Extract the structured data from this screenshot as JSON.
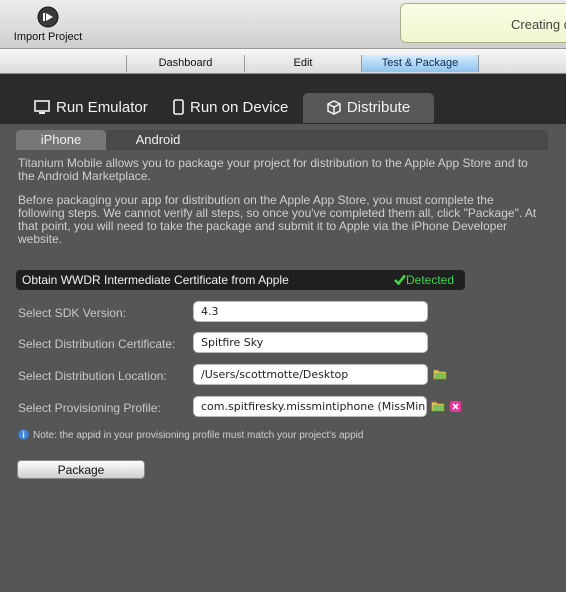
{
  "toolbar": {
    "import_label": "Import Project",
    "status_text": "Creating d"
  },
  "view_tabs": [
    "Dashboard",
    "Edit",
    "Test & Package"
  ],
  "main_tabs": [
    "Run Emulator",
    "Run on Device",
    "Distribute"
  ],
  "sub_tabs": [
    "iPhone",
    "Android"
  ],
  "description": {
    "para1": "Titanium Mobile allows you to package your project for distribution to the Apple App Store and to the Android Marketplace.",
    "para2": "Before packaging your app for distribution on the Apple App Store, you must complete the following steps. We cannot verify all steps, so once you've completed them all, click \"Package\". At that point, you will need to take the package and submit it to Apple via the iPhone Developer website."
  },
  "cert": {
    "label": "Obtain WWDR Intermediate Certificate from Apple",
    "status": "Detected"
  },
  "form": {
    "sdk_label": "Select SDK Version:",
    "sdk_value": "4.3",
    "cert_label": "Select Distribution Certificate:",
    "cert_value": "Spitfire Sky",
    "location_label": "Select Distribution Location:",
    "location_value": "/Users/scottmotte/Desktop",
    "profile_label": "Select Provisioning Profile:",
    "profile_value": "com.spitfiresky.missmintiphone (MissMin D"
  },
  "note": "Note: the appid in your provisioning profile must match your project's appid",
  "package_label": "Package",
  "icons": {
    "import": "import-icon",
    "emulator": "monitor-icon",
    "device": "phone-icon",
    "distribute": "cube-icon",
    "folder": "folder-icon",
    "delete": "delete-icon",
    "info": "info-icon",
    "check": "checkmark-icon"
  },
  "colors": {
    "detected": "#44d34b",
    "active_view_tab": "#8fc3ee",
    "background": "#565656"
  }
}
